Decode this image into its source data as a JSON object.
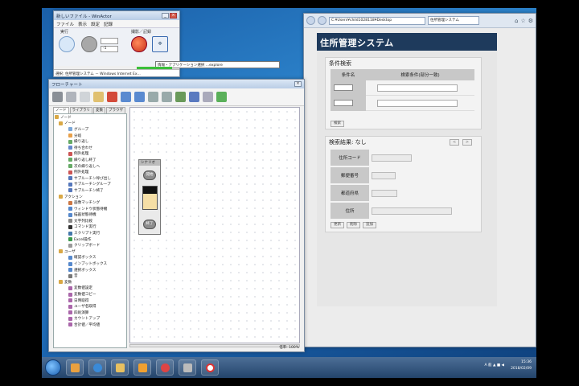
{
  "winactor": {
    "title": "新しいファイル - WinActor",
    "menu": [
      "ファイル",
      "表示",
      "設定",
      "記録"
    ],
    "run_group_label": "実行",
    "record_group_label": "撮影／記録",
    "speed_label": "速度",
    "speed_value": "",
    "loop_value": "-1",
    "status_line": "選択: 住所管理システム － Windows Internet Ex..."
  },
  "tooltip": {
    "text": "情報・アプリケーション選択 ...explore"
  },
  "flowchart": {
    "title": "フローチャート",
    "tabs": [
      "ノード",
      "ライブラリ",
      "変数",
      "ブラウザ"
    ],
    "tree": [
      {
        "level": 0,
        "label": "ノード",
        "color": "#d9a845"
      },
      {
        "level": 1,
        "label": "ノード",
        "color": "#d9a845"
      },
      {
        "level": 2,
        "label": "グループ",
        "color": "#7aa6d8"
      },
      {
        "level": 2,
        "label": "分岐",
        "color": "#e8a04a"
      },
      {
        "level": 2,
        "label": "繰り返し",
        "color": "#66aa66"
      },
      {
        "level": 2,
        "label": "待ち合わせ",
        "color": "#6688cc"
      },
      {
        "level": 2,
        "label": "例外処理",
        "color": "#cc5555"
      },
      {
        "level": 2,
        "label": "繰り返し終了",
        "color": "#66aa66"
      },
      {
        "level": 2,
        "label": "次の繰り返しへ",
        "color": "#66aa66"
      },
      {
        "level": 2,
        "label": "例外処理",
        "color": "#cc5555"
      },
      {
        "level": 2,
        "label": "サブルーチン呼び出し",
        "color": "#5577bb"
      },
      {
        "level": 2,
        "label": "サブルーチングループ",
        "color": "#5577bb"
      },
      {
        "level": 2,
        "label": "サブルーチン終了",
        "color": "#5577bb"
      },
      {
        "level": 1,
        "label": "アクション",
        "color": "#d9a845"
      },
      {
        "level": 2,
        "label": "画像マッチング",
        "color": "#cc7744"
      },
      {
        "level": 2,
        "label": "ウィンドウ状態待機",
        "color": "#5588cc"
      },
      {
        "level": 2,
        "label": "描画状態待機",
        "color": "#5588cc"
      },
      {
        "level": 2,
        "label": "文字列比較",
        "color": "#888888"
      },
      {
        "level": 2,
        "label": "コマンド実行",
        "color": "#333333"
      },
      {
        "level": 2,
        "label": "スクリプト実行",
        "color": "#4477aa"
      },
      {
        "level": 2,
        "label": "Excel操作",
        "color": "#3c9a4c"
      },
      {
        "level": 2,
        "label": "クリップボード",
        "color": "#999999"
      },
      {
        "level": 1,
        "label": "ユーザ",
        "color": "#d9a845"
      },
      {
        "level": 2,
        "label": "確認ボックス",
        "color": "#5588cc"
      },
      {
        "level": 2,
        "label": "インプットボックス",
        "color": "#5588cc"
      },
      {
        "level": 2,
        "label": "選択ボックス",
        "color": "#5588cc"
      },
      {
        "level": 2,
        "label": "音",
        "color": "#777777"
      },
      {
        "level": 1,
        "label": "変数",
        "color": "#d9a845"
      },
      {
        "level": 2,
        "label": "変数値設定",
        "color": "#aa66aa"
      },
      {
        "level": 2,
        "label": "変数値コピー",
        "color": "#aa66aa"
      },
      {
        "level": 2,
        "label": "日時取得",
        "color": "#aa66aa"
      },
      {
        "level": 2,
        "label": "ユーザ名取得",
        "color": "#aa66aa"
      },
      {
        "level": 2,
        "label": "四則演算",
        "color": "#aa66aa"
      },
      {
        "level": 2,
        "label": "カウントアップ",
        "color": "#aa66aa"
      },
      {
        "level": 2,
        "label": "合計値／平均値",
        "color": "#aa66aa"
      }
    ],
    "scenario_label": "シナリオ",
    "start_label": "開始",
    "end_label": "終了",
    "status": "倍率: 100%"
  },
  "browser": {
    "address": "C:¥Users¥child1028118¥Desktop",
    "tab_title": "住所管理システム",
    "app_title": "住所管理システム",
    "search": {
      "title": "条件検索",
      "col_name": "条件名",
      "col_cond": "検索条件(部分一致)",
      "search_button": "検索"
    },
    "result": {
      "title": "検索結果: なし",
      "prev": "<",
      "next": ">",
      "fields": [
        "住所コード",
        "郵便番号",
        "都道府県",
        "住所"
      ],
      "buttons": [
        "更新",
        "削除",
        "追加"
      ]
    }
  },
  "taskbar": {
    "time": "15:36",
    "date": "2018/02/09",
    "tray_text": "A 般 ▲ ■ ◀"
  },
  "colors": {
    "app_header": "#1e3a5c",
    "desktop": "#2d84cc"
  }
}
